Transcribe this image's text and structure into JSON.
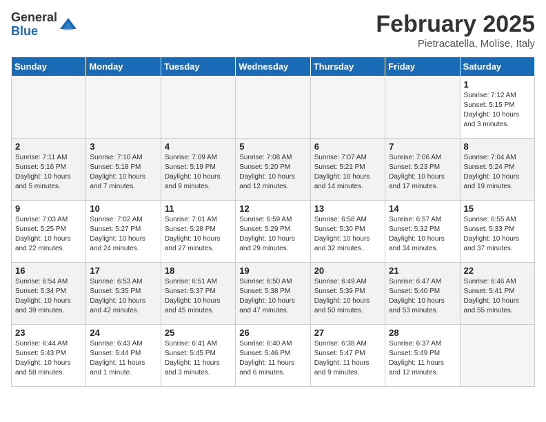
{
  "logo": {
    "general": "General",
    "blue": "Blue"
  },
  "title": "February 2025",
  "location": "Pietracatella, Molise, Italy",
  "weekdays": [
    "Sunday",
    "Monday",
    "Tuesday",
    "Wednesday",
    "Thursday",
    "Friday",
    "Saturday"
  ],
  "weeks": [
    [
      {
        "day": "",
        "info": ""
      },
      {
        "day": "",
        "info": ""
      },
      {
        "day": "",
        "info": ""
      },
      {
        "day": "",
        "info": ""
      },
      {
        "day": "",
        "info": ""
      },
      {
        "day": "",
        "info": ""
      },
      {
        "day": "1",
        "info": "Sunrise: 7:12 AM\nSunset: 5:15 PM\nDaylight: 10 hours\nand 3 minutes."
      }
    ],
    [
      {
        "day": "2",
        "info": "Sunrise: 7:11 AM\nSunset: 5:16 PM\nDaylight: 10 hours\nand 5 minutes."
      },
      {
        "day": "3",
        "info": "Sunrise: 7:10 AM\nSunset: 5:18 PM\nDaylight: 10 hours\nand 7 minutes."
      },
      {
        "day": "4",
        "info": "Sunrise: 7:09 AM\nSunset: 5:19 PM\nDaylight: 10 hours\nand 9 minutes."
      },
      {
        "day": "5",
        "info": "Sunrise: 7:08 AM\nSunset: 5:20 PM\nDaylight: 10 hours\nand 12 minutes."
      },
      {
        "day": "6",
        "info": "Sunrise: 7:07 AM\nSunset: 5:21 PM\nDaylight: 10 hours\nand 14 minutes."
      },
      {
        "day": "7",
        "info": "Sunrise: 7:06 AM\nSunset: 5:23 PM\nDaylight: 10 hours\nand 17 minutes."
      },
      {
        "day": "8",
        "info": "Sunrise: 7:04 AM\nSunset: 5:24 PM\nDaylight: 10 hours\nand 19 minutes."
      }
    ],
    [
      {
        "day": "9",
        "info": "Sunrise: 7:03 AM\nSunset: 5:25 PM\nDaylight: 10 hours\nand 22 minutes."
      },
      {
        "day": "10",
        "info": "Sunrise: 7:02 AM\nSunset: 5:27 PM\nDaylight: 10 hours\nand 24 minutes."
      },
      {
        "day": "11",
        "info": "Sunrise: 7:01 AM\nSunset: 5:28 PM\nDaylight: 10 hours\nand 27 minutes."
      },
      {
        "day": "12",
        "info": "Sunrise: 6:59 AM\nSunset: 5:29 PM\nDaylight: 10 hours\nand 29 minutes."
      },
      {
        "day": "13",
        "info": "Sunrise: 6:58 AM\nSunset: 5:30 PM\nDaylight: 10 hours\nand 32 minutes."
      },
      {
        "day": "14",
        "info": "Sunrise: 6:57 AM\nSunset: 5:32 PM\nDaylight: 10 hours\nand 34 minutes."
      },
      {
        "day": "15",
        "info": "Sunrise: 6:55 AM\nSunset: 5:33 PM\nDaylight: 10 hours\nand 37 minutes."
      }
    ],
    [
      {
        "day": "16",
        "info": "Sunrise: 6:54 AM\nSunset: 5:34 PM\nDaylight: 10 hours\nand 39 minutes."
      },
      {
        "day": "17",
        "info": "Sunrise: 6:53 AM\nSunset: 5:35 PM\nDaylight: 10 hours\nand 42 minutes."
      },
      {
        "day": "18",
        "info": "Sunrise: 6:51 AM\nSunset: 5:37 PM\nDaylight: 10 hours\nand 45 minutes."
      },
      {
        "day": "19",
        "info": "Sunrise: 6:50 AM\nSunset: 5:38 PM\nDaylight: 10 hours\nand 47 minutes."
      },
      {
        "day": "20",
        "info": "Sunrise: 6:49 AM\nSunset: 5:39 PM\nDaylight: 10 hours\nand 50 minutes."
      },
      {
        "day": "21",
        "info": "Sunrise: 6:47 AM\nSunset: 5:40 PM\nDaylight: 10 hours\nand 53 minutes."
      },
      {
        "day": "22",
        "info": "Sunrise: 6:46 AM\nSunset: 5:41 PM\nDaylight: 10 hours\nand 55 minutes."
      }
    ],
    [
      {
        "day": "23",
        "info": "Sunrise: 6:44 AM\nSunset: 5:43 PM\nDaylight: 10 hours\nand 58 minutes."
      },
      {
        "day": "24",
        "info": "Sunrise: 6:43 AM\nSunset: 5:44 PM\nDaylight: 11 hours\nand 1 minute."
      },
      {
        "day": "25",
        "info": "Sunrise: 6:41 AM\nSunset: 5:45 PM\nDaylight: 11 hours\nand 3 minutes."
      },
      {
        "day": "26",
        "info": "Sunrise: 6:40 AM\nSunset: 5:46 PM\nDaylight: 11 hours\nand 6 minutes."
      },
      {
        "day": "27",
        "info": "Sunrise: 6:38 AM\nSunset: 5:47 PM\nDaylight: 11 hours\nand 9 minutes."
      },
      {
        "day": "28",
        "info": "Sunrise: 6:37 AM\nSunset: 5:49 PM\nDaylight: 11 hours\nand 12 minutes."
      },
      {
        "day": "",
        "info": ""
      }
    ]
  ]
}
